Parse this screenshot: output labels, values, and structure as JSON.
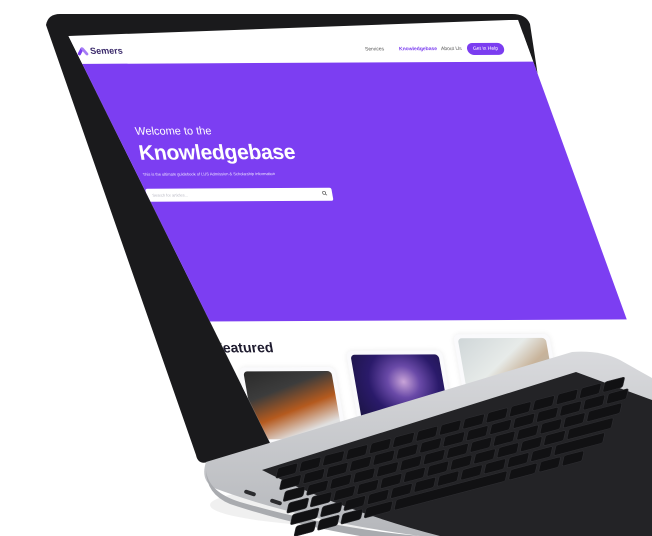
{
  "app": {
    "logo_text": "Semers",
    "brand_color": "#7c3ef2"
  },
  "nav": {
    "items": [
      "Services",
      "Knowledgebase",
      "About Us"
    ],
    "active_index": 1,
    "cta_label": "Get in Help"
  },
  "hero": {
    "kicker": "Welcome to the",
    "title": "Knowledgebase",
    "subtitle": "This is the ultimate guidebook of LUS Admission & Scholarship information",
    "search_placeholder": "Search for articles..."
  },
  "featured": {
    "heading": "Featured",
    "cards": [
      {
        "image": "laptop-desk-photo"
      },
      {
        "image": "person-purple-light-photo"
      },
      {
        "image": "hands-laptop-photo"
      }
    ]
  },
  "icons": {
    "search": "search-icon"
  }
}
